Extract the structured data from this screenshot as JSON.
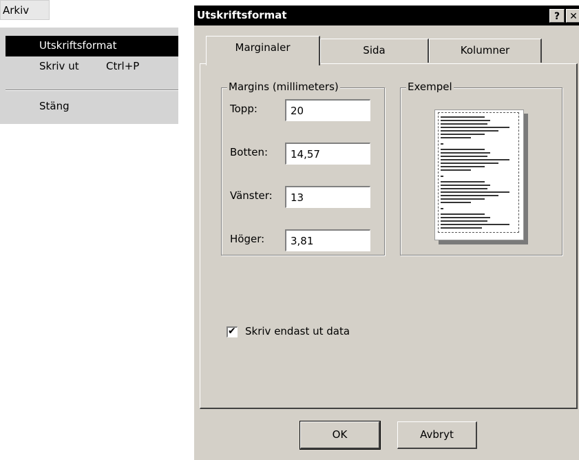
{
  "menu": {
    "title": "Arkiv",
    "items": [
      {
        "label": "Utskriftsformat",
        "shortcut": ""
      },
      {
        "label": "Skriv ut",
        "shortcut": "Ctrl+P"
      },
      {
        "label": "Stäng",
        "shortcut": ""
      }
    ]
  },
  "dialog": {
    "title": "Utskriftsformat",
    "help_label": "?",
    "close_label": "✕",
    "tabs": [
      {
        "label": "Marginaler"
      },
      {
        "label": "Sida"
      },
      {
        "label": "Kolumner"
      }
    ],
    "margins": {
      "legend": "Margins (millimeters)",
      "fields": [
        {
          "label": "Topp:",
          "value": "20"
        },
        {
          "label": "Botten:",
          "value": "14,57"
        },
        {
          "label": "Vänster:",
          "value": "13"
        },
        {
          "label": "Höger:",
          "value": "3,81"
        }
      ]
    },
    "example": {
      "legend": "Exempel"
    },
    "checkbox": {
      "label": "Skriv endast ut data",
      "checked": true,
      "mark": "✔"
    },
    "buttons": {
      "ok": "OK",
      "cancel": "Avbryt"
    }
  }
}
